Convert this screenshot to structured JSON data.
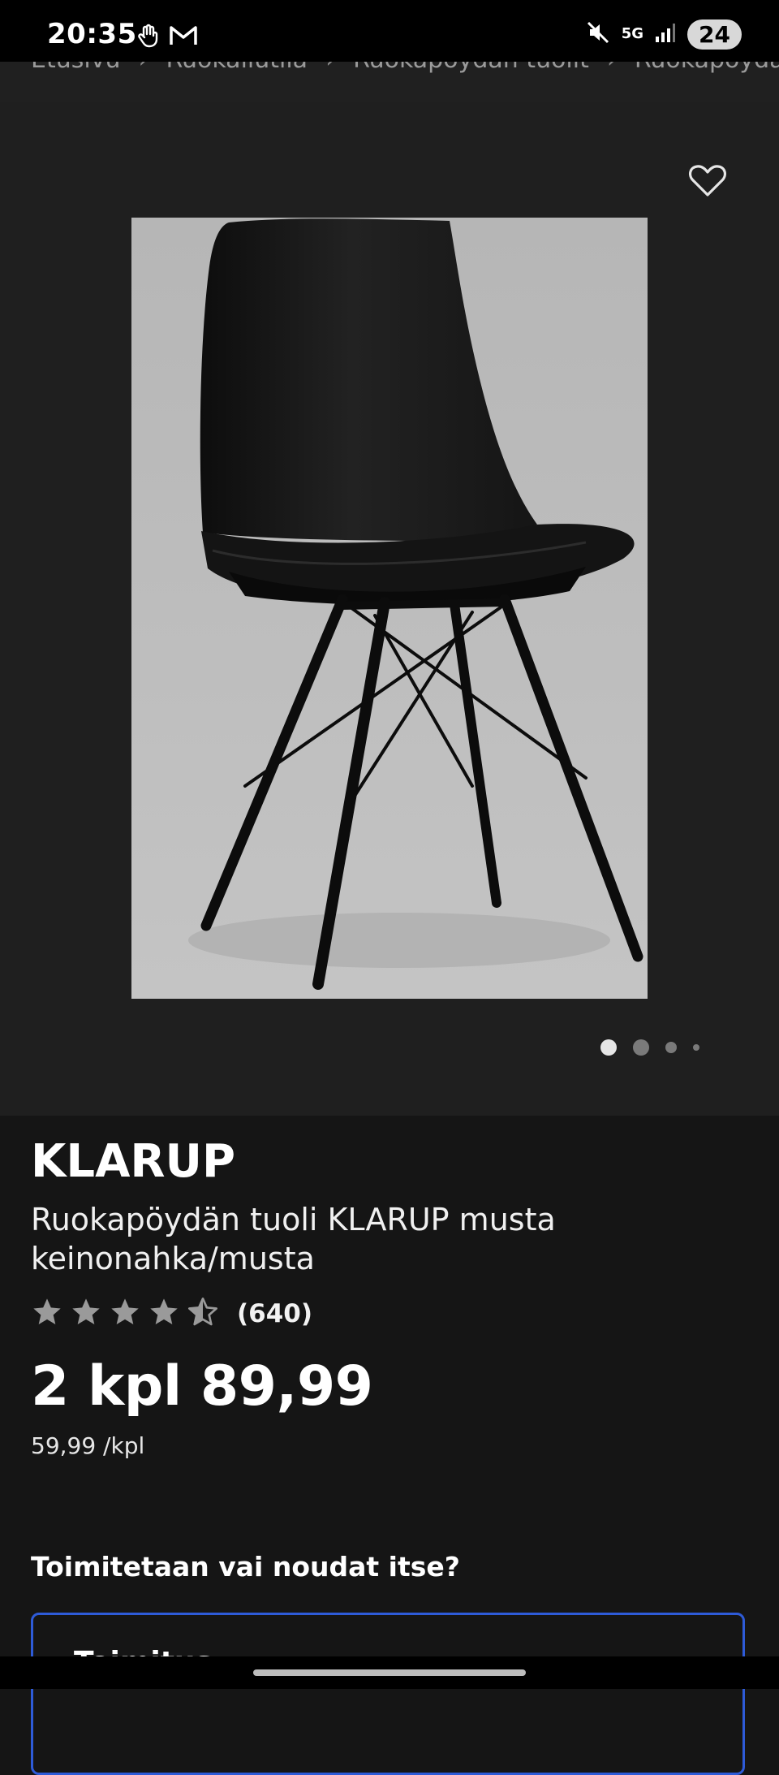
{
  "status_bar": {
    "time": "20:35",
    "network": "5G",
    "battery": "24",
    "icons": [
      "hand-gesture-icon",
      "gmail-icon",
      "mute-icon",
      "5g-icon",
      "signal-icon",
      "battery-icon"
    ]
  },
  "breadcrumb": {
    "items": [
      "Etusivu",
      "Ruokailutila",
      "Ruokapöydän tuolit",
      "Ruokapöydän"
    ],
    "separator": "›"
  },
  "gallery": {
    "image_alt": "Ruokapöydän tuoli KLARUP musta",
    "slide_count": 4,
    "active_slide": 1
  },
  "product": {
    "brand": "KLARUP",
    "description": "Ruokapöydän tuoli KLARUP musta keinonahka/musta",
    "rating": 4.5,
    "rating_count": "(640)",
    "price": "2 kpl 89,99",
    "unit_price": "59,99 /kpl"
  },
  "delivery": {
    "heading": "Toimitetaan vai noudat itse?",
    "option_label": "Toimitus"
  },
  "colors": {
    "background": "#151515",
    "gallery_background": "#1f1f1f",
    "accent_border": "#2e5bd8",
    "star": "#9a9a9a"
  }
}
